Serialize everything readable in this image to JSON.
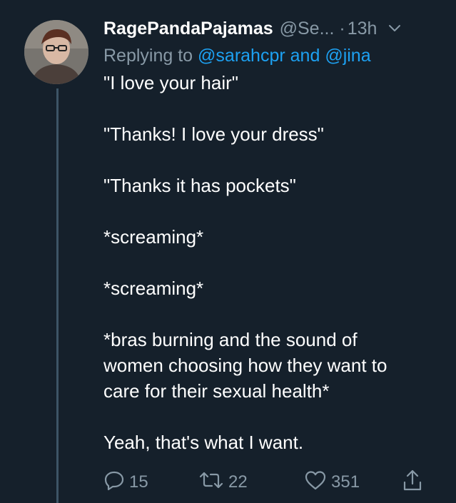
{
  "tweet": {
    "display_name": "RagePandaPajamas",
    "handle": "@Se...",
    "separator": "·",
    "timestamp": "13h",
    "reply_prefix": "Replying to",
    "reply_mention_1": "@sarahcpr",
    "reply_and": "and",
    "reply_mention_2": "@jina",
    "body": {
      "line_1": "\"I love your hair\"",
      "line_2": "\"Thanks! I love your dress\"",
      "line_3": "\"Thanks it has pockets\"",
      "line_4": "*screaming*",
      "line_5": "*screaming*",
      "line_6a": "*bras burning and the sound of",
      "line_6b": "women choosing how they want to",
      "line_6c": "care for their sexual health*",
      "line_7": "Yeah, that's what I want."
    }
  },
  "actions": {
    "reply_count": "15",
    "retweet_count": "22",
    "like_count": "351"
  },
  "icons": {
    "caret": "chevron-down-icon",
    "reply": "reply-icon",
    "retweet": "retweet-icon",
    "like": "heart-icon",
    "share": "share-icon"
  },
  "colors": {
    "background": "#15202b",
    "secondary_text": "#8899a6",
    "link": "#1da1f2",
    "thread_line": "#3d5466"
  }
}
